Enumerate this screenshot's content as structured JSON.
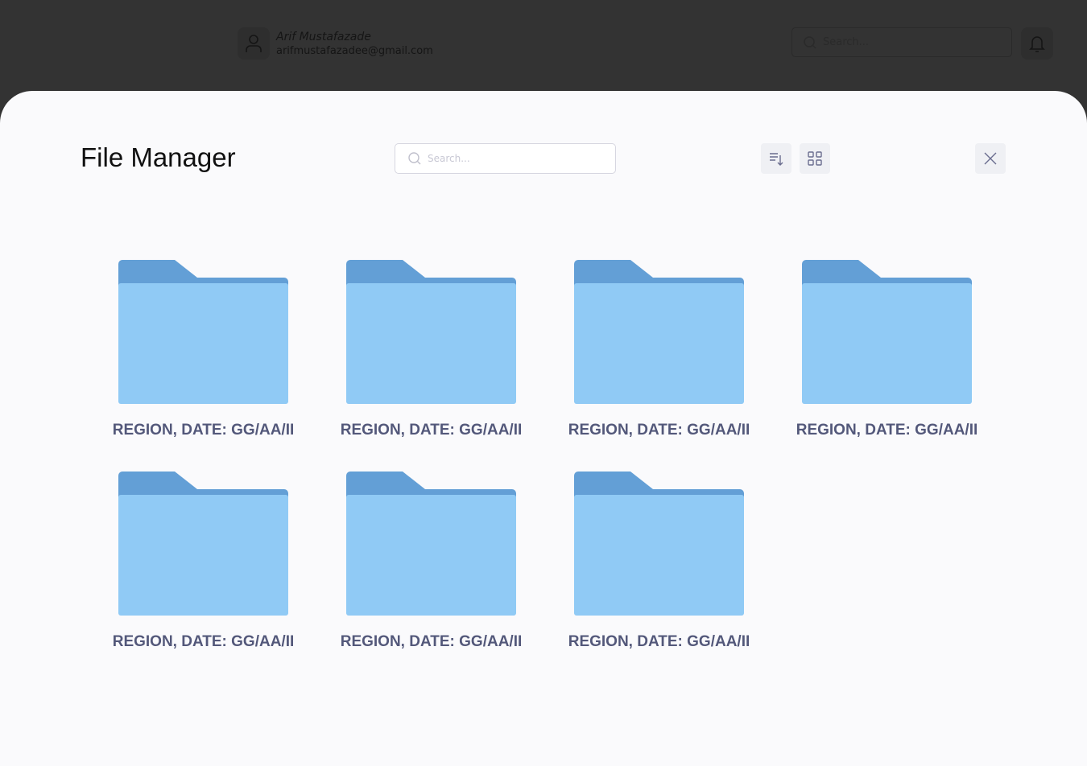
{
  "header": {
    "user_name": "Arif Mustafazade",
    "user_email": "arifmustafazadee@gmail.com",
    "search_placeholder": "Search..."
  },
  "modal": {
    "title": "File Manager",
    "search_placeholder": "Search...",
    "folders": [
      {
        "label": "REGION, DATE: GG/AA/II"
      },
      {
        "label": "REGION, DATE: GG/AA/II"
      },
      {
        "label": "REGION, DATE: GG/AA/II"
      },
      {
        "label": "REGION, DATE: GG/AA/II"
      },
      {
        "label": "REGION, DATE: GG/AA/II"
      },
      {
        "label": "REGION, DATE: GG/AA/II"
      },
      {
        "label": "REGION, DATE: GG/AA/II"
      }
    ]
  },
  "colors": {
    "folder_back": "#639fd6",
    "folder_front": "#90caf5",
    "label": "#53587a"
  }
}
